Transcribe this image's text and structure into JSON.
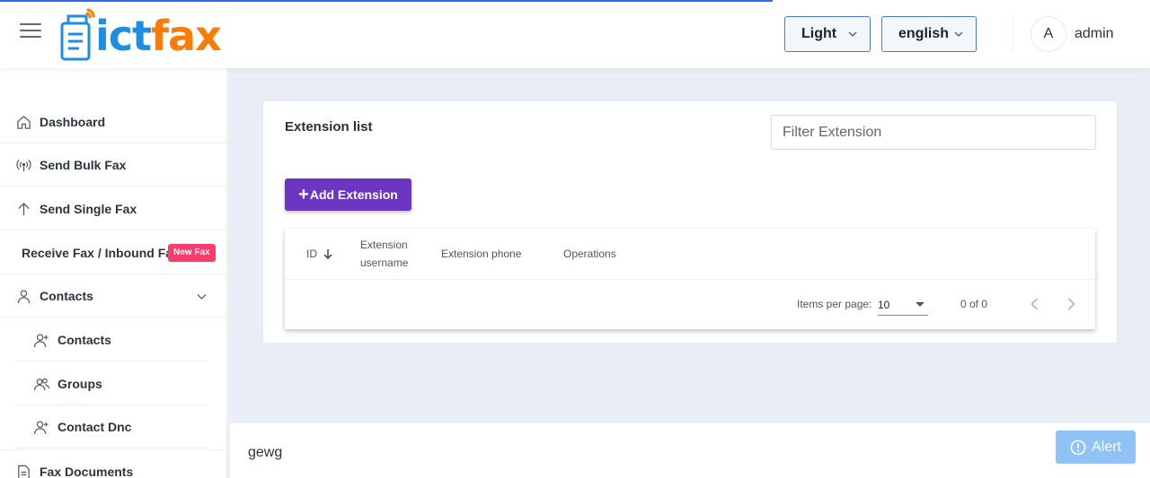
{
  "header": {
    "brand": {
      "part1": "ict",
      "part2": "fax",
      "colors": {
        "blue": "#1e8fe0",
        "orange": "#ff7a00"
      }
    },
    "theme_select": {
      "value": "Light"
    },
    "language_select": {
      "value": "english"
    },
    "user": {
      "avatar_initial": "A",
      "name": "admin"
    }
  },
  "sidebar": {
    "items": [
      {
        "label": "Dashboard",
        "icon": "home-icon"
      },
      {
        "label": "Send Bulk Fax",
        "icon": "broadcast-icon"
      },
      {
        "label": "Send Single Fax",
        "icon": "arrow-up-icon"
      },
      {
        "label": "Receive Fax / Inbound Fax",
        "badge": "New Fax"
      },
      {
        "label": "Contacts",
        "icon": "person-icon",
        "expanded": true,
        "children": [
          {
            "label": "Contacts",
            "icon": "person-add-icon"
          },
          {
            "label": "Groups",
            "icon": "people-icon"
          },
          {
            "label": "Contact Dnc",
            "icon": "person-add-icon"
          }
        ]
      },
      {
        "label": "Fax Documents",
        "icon": "document-icon"
      }
    ]
  },
  "main": {
    "title": "Extension list",
    "filter": {
      "placeholder": "Filter Extension",
      "value": ""
    },
    "add_button": {
      "icon": "+",
      "label": "Add Extension"
    },
    "table": {
      "columns": [
        "ID",
        "Extension username",
        "Extension phone",
        "Operations"
      ],
      "rows": []
    },
    "paginator": {
      "items_per_page_label": "Items per page:",
      "items_per_page": "10",
      "range": "0 of 0"
    }
  },
  "footer": {
    "text": "gewg",
    "alert_button": "Alert"
  },
  "colors": {
    "accent": "#6a36c2",
    "select_border": "#4a7bd6",
    "badge": "#ff3b6b",
    "alert": "#8fc3f5"
  }
}
